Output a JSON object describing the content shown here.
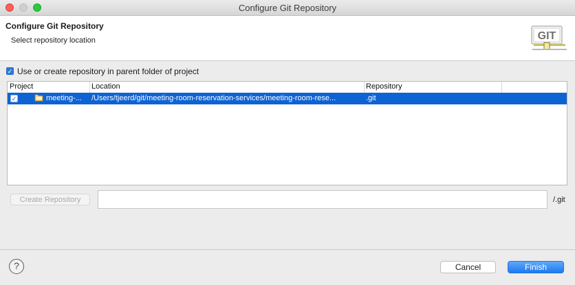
{
  "window": {
    "title": "Configure Git Repository"
  },
  "header": {
    "title": "Configure Git Repository",
    "subtitle": "Select repository location",
    "logo_text": "GIT"
  },
  "options": {
    "use_parent_repo_label": "Use or create repository in parent folder of project",
    "use_parent_repo_checked": true
  },
  "table": {
    "columns": [
      "Project",
      "Location",
      "Repository"
    ],
    "rows": [
      {
        "checked": true,
        "project": "meeting-...",
        "location": "/Users/tjeerd/git/meeting-room-reservation-services/meeting-room-rese...",
        "repository": ".git",
        "selected": true
      }
    ]
  },
  "create": {
    "button_label": "Create Repository",
    "path_value": "",
    "suffix": "/.git"
  },
  "footer": {
    "help_icon": "help-icon",
    "cancel_label": "Cancel",
    "finish_label": "Finish"
  },
  "colors": {
    "selection": "#0e63d4",
    "accent": "#2e7bd6",
    "finish": "#1f79f0"
  }
}
